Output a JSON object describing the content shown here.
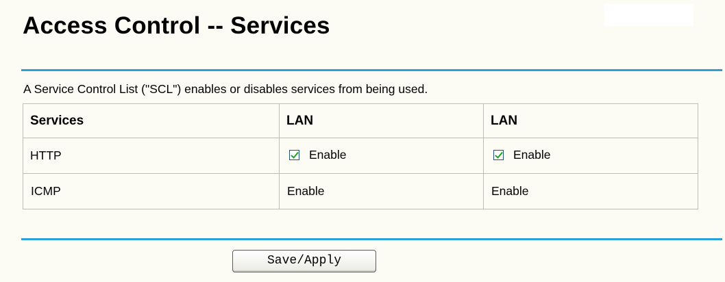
{
  "page": {
    "title": "Access Control -- Services",
    "description": "A Service Control List (\"SCL\") enables or disables services from being used."
  },
  "table": {
    "headers": [
      "Services",
      "LAN",
      "LAN"
    ],
    "rows": [
      {
        "service": "HTTP",
        "lan1": {
          "checked": true,
          "label": "Enable"
        },
        "lan2": {
          "checked": true,
          "label": "Enable"
        }
      },
      {
        "service": "ICMP",
        "lan1": {
          "label": "Enable"
        },
        "lan2": {
          "label": "Enable"
        }
      }
    ]
  },
  "actions": {
    "save_label": "Save/Apply"
  },
  "colors": {
    "rule": "#2a9fd6",
    "background": "#fcfcf4",
    "check": "#21a121"
  },
  "icons": {
    "checkbox": "checkbox-checked-icon"
  }
}
